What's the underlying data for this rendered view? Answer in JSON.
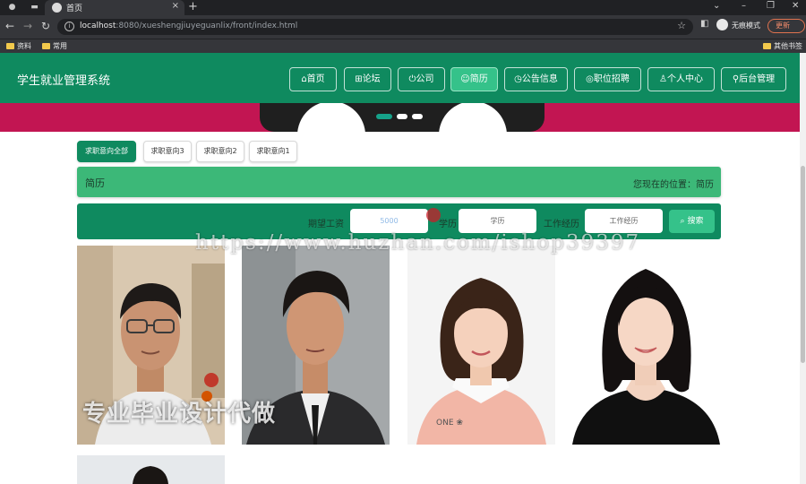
{
  "browser": {
    "tabs": [
      {
        "title": "首页"
      }
    ],
    "url_host": "localhost",
    "url_rest": ":8080/xueshengjiuyeguanlix/front/index.html",
    "incognito_label": "无痕模式",
    "update_label": "更新",
    "bookmarks": [
      "资料",
      "常用"
    ],
    "other_bookmarks": "其他书签"
  },
  "site": {
    "title": "学生就业管理系统",
    "nav": [
      "首页",
      "论坛",
      "公司",
      "简历",
      "公告信息",
      "职位招聘",
      "个人中心",
      "后台管理"
    ],
    "active_nav": "简历"
  },
  "filter_tabs": [
    "求职意向全部",
    "求职意向3",
    "求职意向2",
    "求职意向1"
  ],
  "page_title": "简历",
  "location": "您现在的位置：简历",
  "search": {
    "salary_label": "期望工资",
    "salary_value": "5000",
    "education_label": "学历",
    "education_placeholder": "学历",
    "experience_label": "工作经历",
    "experience_placeholder": "工作经历",
    "button": "搜索"
  },
  "overlay": {
    "watermark": "https://www.huzhan.com/ishop39397",
    "stamp": "专业毕业设计代做"
  },
  "colors": {
    "header": "#0f8a5f",
    "active": "#35c28a",
    "titlebar": "#3cb878",
    "banner": "#c21552"
  }
}
